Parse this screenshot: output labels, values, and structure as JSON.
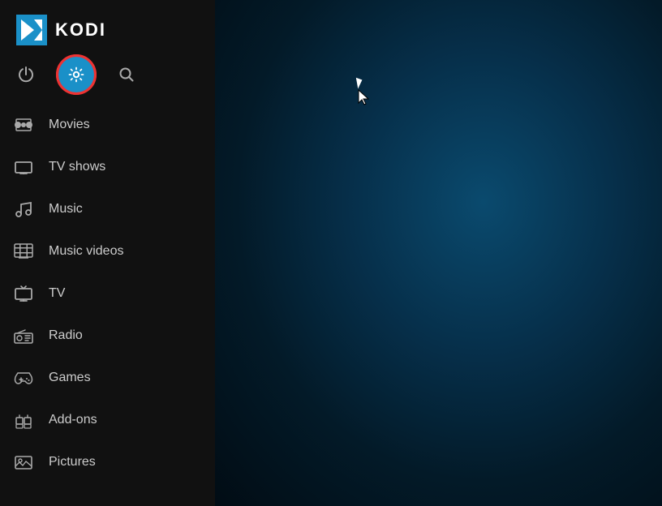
{
  "app": {
    "name": "KODI"
  },
  "top_icons": [
    {
      "id": "power",
      "label": "Power",
      "symbol": "power-icon"
    },
    {
      "id": "settings",
      "label": "Settings",
      "symbol": "gear-icon",
      "active": true
    },
    {
      "id": "search",
      "label": "Search",
      "symbol": "search-icon"
    }
  ],
  "nav_items": [
    {
      "id": "movies",
      "label": "Movies",
      "icon": "movies-icon"
    },
    {
      "id": "tv-shows",
      "label": "TV shows",
      "icon": "tv-shows-icon"
    },
    {
      "id": "music",
      "label": "Music",
      "icon": "music-icon"
    },
    {
      "id": "music-videos",
      "label": "Music videos",
      "icon": "music-videos-icon"
    },
    {
      "id": "tv",
      "label": "TV",
      "icon": "tv-icon"
    },
    {
      "id": "radio",
      "label": "Radio",
      "icon": "radio-icon"
    },
    {
      "id": "games",
      "label": "Games",
      "icon": "games-icon"
    },
    {
      "id": "add-ons",
      "label": "Add-ons",
      "icon": "add-ons-icon"
    },
    {
      "id": "pictures",
      "label": "Pictures",
      "icon": "pictures-icon"
    }
  ]
}
